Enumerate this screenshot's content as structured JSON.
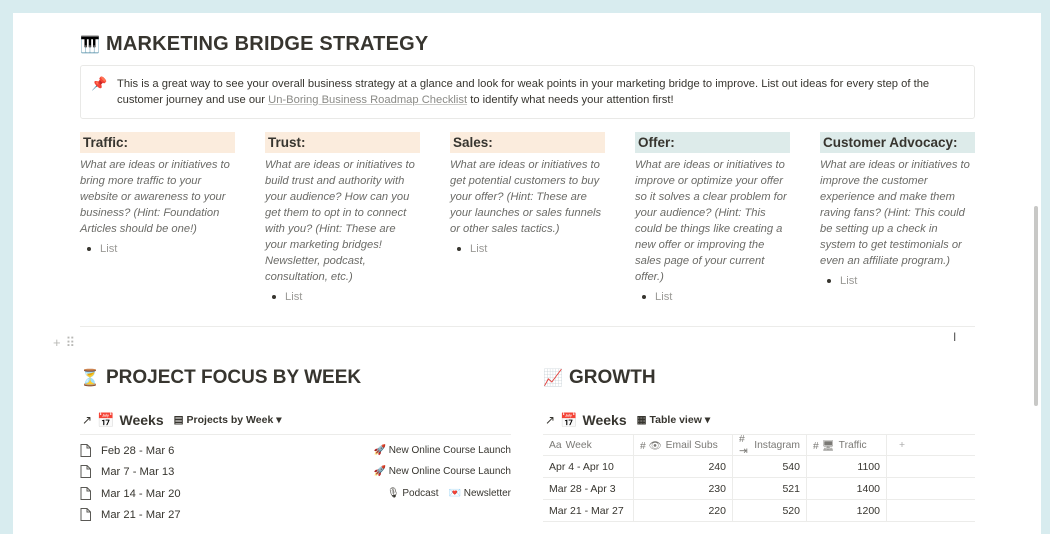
{
  "marketing": {
    "icon": "🎹",
    "title": "MARKETING BRIDGE STRATEGY",
    "callout": {
      "icon": "📌",
      "text_before": "This is a great way to see your overall business strategy at a glance and look for weak points in your marketing bridge to improve. List out ideas for every step of the customer journey and use our ",
      "link_text": "Un-Boring Business Roadmap Checklist",
      "text_after": " to identify what needs your attention first!"
    },
    "columns": [
      {
        "title": "Traffic:",
        "color": "#fbecdd",
        "desc": "What are ideas or initiatives to bring more traffic to your website or awareness to your business? (Hint: Foundation Articles should be one!)",
        "item": "List"
      },
      {
        "title": "Trust:",
        "color": "#fbecdd",
        "desc": "What are ideas or initiatives to build trust and authority with your audience? How can you get them to opt in to connect with you? (Hint: These are your marketing bridges! Newsletter, podcast, consultation, etc.)",
        "item": "List"
      },
      {
        "title": "Sales:",
        "color": "#fbecdd",
        "desc": "What are ideas or initiatives to get potential customers to buy your offer? (Hint: These are your launches or sales funnels or other sales tactics.)",
        "item": "List"
      },
      {
        "title": "Offer:",
        "color": "#ddebea",
        "desc": "What are ideas or initiatives to improve or optimize your offer so it solves a clear problem for your audience? (Hint: This could be things like creating a new offer or improving the sales page of your current offer.)",
        "item": "List"
      },
      {
        "title": "Customer Advocacy:",
        "color": "#ddebea",
        "desc": "What are ideas or initiatives to improve the customer experience and make them raving fans? (Hint: This could be setting up a check in system to get testimonials or even an affiliate program.)",
        "item": "List"
      }
    ]
  },
  "project": {
    "icon": "⏳",
    "title": "PROJECT FOCUS BY WEEK",
    "db": {
      "arrow": "↗",
      "icon": "📅",
      "name": "Weeks",
      "view_icon": "▤",
      "view": "Projects by Week",
      "chevron": "▾"
    },
    "rows": [
      {
        "title": "Feb 28 - Mar 6",
        "tags": [
          {
            "icon": "🚀",
            "label": "New Online Course Launch"
          }
        ]
      },
      {
        "title": "Mar 7 - Mar 13",
        "tags": [
          {
            "icon": "🚀",
            "label": "New Online Course Launch"
          }
        ]
      },
      {
        "title": "Mar 14 - Mar 20",
        "tags": [
          {
            "icon": "🎙",
            "label": "Podcast"
          },
          {
            "icon": "💌",
            "label": "Newsletter"
          }
        ]
      },
      {
        "title": "Mar 21 - Mar 27",
        "tags": []
      }
    ]
  },
  "growth": {
    "icon": "📈",
    "title": "GROWTH",
    "db": {
      "arrow": "↗",
      "icon": "📅",
      "name": "Weeks",
      "view_icon": "▦",
      "view": "Table view",
      "chevron": "▾"
    },
    "columns": [
      {
        "icon": "Aa",
        "label": "Week"
      },
      {
        "icon": "# 👁",
        "label": "Email Subs"
      },
      {
        "icon": "# ⇥",
        "label": "Instagram"
      },
      {
        "icon": "# 🖥",
        "label": "Traffic"
      },
      {
        "icon": "+",
        "label": ""
      }
    ],
    "rows": [
      {
        "week": "Apr 4 - Apr 10",
        "email": "240",
        "instagram": "540",
        "traffic": "1100"
      },
      {
        "week": "Mar 28 - Apr 3",
        "email": "230",
        "instagram": "521",
        "traffic": "1400"
      },
      {
        "week": "Mar 21 - Mar 27",
        "email": "220",
        "instagram": "520",
        "traffic": "1200"
      }
    ]
  },
  "gutter": {
    "plus": "+",
    "drag": "⠿"
  }
}
